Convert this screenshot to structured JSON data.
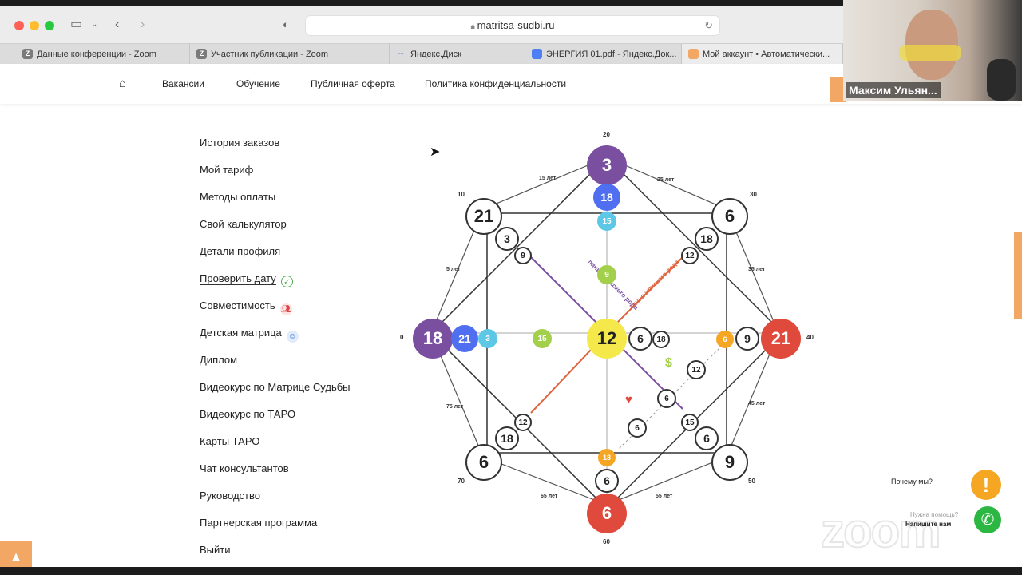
{
  "browser": {
    "url": "matritsa-sudbi.ru",
    "tabs": [
      {
        "label": "Данные конференции - Zoom",
        "icon": "zoom-icon"
      },
      {
        "label": "Участник публикации - Zoom",
        "icon": "zoom-icon"
      },
      {
        "label": "Яндекс.Диск",
        "icon": "yandex-disk-icon"
      },
      {
        "label": "ЭНЕРГИЯ 01.pdf - Яндекс.Док...",
        "icon": "document-icon"
      },
      {
        "label": "Мой аккаунт • Автоматически...",
        "icon": "site-icon"
      }
    ]
  },
  "nav": {
    "links": [
      "Вакансии",
      "Обучение",
      "Публичная оферта",
      "Политика конфиденциальности"
    ]
  },
  "sidebar": {
    "items": [
      "История заказов",
      "Мой тариф",
      "Методы оплаты",
      "Свой калькулятор",
      "Детали профиля",
      "Проверить дату",
      "Совместимость",
      "Детская матрица",
      "Диплом",
      "Видеокурс по Матрице Судьбы",
      "Видеокурс по ТАРО",
      "Карты ТАРО",
      "Чат консультантов",
      "Руководство",
      "Партнерская программа",
      "Выйти"
    ]
  },
  "matrix": {
    "center": "12",
    "top": "3",
    "top_2": "18",
    "top_3": "15",
    "top_4": "9",
    "left": "18",
    "left_2": "21",
    "left_3": "3",
    "left_4": "15",
    "right": "21",
    "right_2": "9",
    "right_3": "6",
    "bottom": "6",
    "bottom_2": "6",
    "bottom_3": "18",
    "top_left": "21",
    "top_left_2": "3",
    "top_left_3": "9",
    "top_right": "6",
    "top_right_2": "18",
    "top_right_3": "12",
    "bottom_left": "6",
    "bottom_left_2": "18",
    "bottom_left_3": "12",
    "bottom_right": "9",
    "bottom_right_2": "6",
    "bottom_right_3": "15",
    "center_right_1": "6",
    "center_right_2": "18",
    "money_1": "12",
    "money_2": "6",
    "love": "6",
    "male_line": "линия мужского рода",
    "female_line": "линия женского рода",
    "ages": {
      "top": "20",
      "left": "0",
      "right": "40",
      "bottom": "60",
      "tl": "10",
      "tr": "30",
      "bl": "70",
      "br": "50",
      "unit": "лет",
      "a5": "5 лет",
      "a15": "15 лет",
      "a25": "25 лет",
      "a35": "35 лет",
      "a45": "45 лет",
      "a55": "55 лет",
      "a65": "65 лет",
      "a75": "75 лет"
    }
  },
  "webcam": {
    "name": "Максим Ульян..."
  },
  "widgets": {
    "why": "Почему мы?",
    "ask": "Нужна помощь?",
    "write": "Напишите нам",
    "zoom": "zoom"
  }
}
